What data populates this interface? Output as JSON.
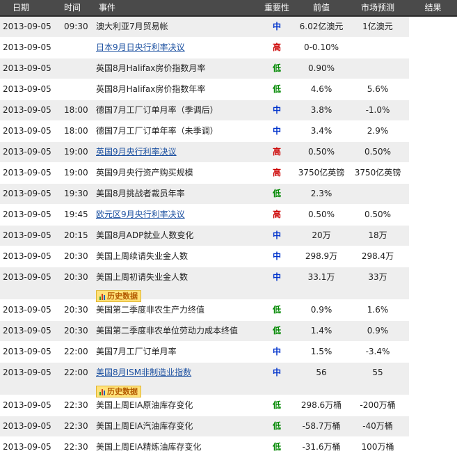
{
  "header": {
    "date": "日期",
    "time": "时间",
    "event": "事件",
    "importance": "重要性",
    "previous": "前值",
    "forecast": "市场预测",
    "result": "结果"
  },
  "history_label": "历史数据",
  "rows": [
    {
      "date": "2013-09-05",
      "time": "09:30",
      "event": "澳大利亚7月贸易帐",
      "link": false,
      "importance": "中",
      "level": "mid",
      "previous": "6.02亿澳元",
      "forecast": "1亿澳元",
      "history": false
    },
    {
      "date": "2013-09-05",
      "time": "",
      "event": "日本9月日央行利率决议",
      "link": true,
      "importance": "高",
      "level": "high",
      "previous": "0-0.10%",
      "forecast": "",
      "history": false
    },
    {
      "date": "2013-09-05",
      "time": "",
      "event": "英国8月Halifax房价指数月率",
      "link": false,
      "importance": "低",
      "level": "low",
      "previous": "0.90%",
      "forecast": "",
      "history": false
    },
    {
      "date": "2013-09-05",
      "time": "",
      "event": "英国8月Halifax房价指数年率",
      "link": false,
      "importance": "低",
      "level": "low",
      "previous": "4.6%",
      "forecast": "5.6%",
      "history": false
    },
    {
      "date": "2013-09-05",
      "time": "18:00",
      "event": "德国7月工厂订单月率（季调后）",
      "link": false,
      "importance": "中",
      "level": "mid",
      "previous": "3.8%",
      "forecast": "-1.0%",
      "history": false
    },
    {
      "date": "2013-09-05",
      "time": "18:00",
      "event": "德国7月工厂订单年率（未季调）",
      "link": false,
      "importance": "中",
      "level": "mid",
      "previous": "3.4%",
      "forecast": "2.9%",
      "history": false
    },
    {
      "date": "2013-09-05",
      "time": "19:00",
      "event": "英国9月央行利率决议",
      "link": true,
      "importance": "高",
      "level": "high",
      "previous": "0.50%",
      "forecast": "0.50%",
      "history": false
    },
    {
      "date": "2013-09-05",
      "time": "19:00",
      "event": "英国9月央行资产购买规模",
      "link": false,
      "importance": "高",
      "level": "high",
      "previous": "3750亿英镑",
      "forecast": "3750亿英镑",
      "history": false
    },
    {
      "date": "2013-09-05",
      "time": "19:30",
      "event": "美国8月挑战者裁员年率",
      "link": false,
      "importance": "低",
      "level": "low",
      "previous": "2.3%",
      "forecast": "",
      "history": false
    },
    {
      "date": "2013-09-05",
      "time": "19:45",
      "event": "欧元区9月央行利率决议",
      "link": true,
      "importance": "高",
      "level": "high",
      "previous": "0.50%",
      "forecast": "0.50%",
      "history": false
    },
    {
      "date": "2013-09-05",
      "time": "20:15",
      "event": "美国8月ADP就业人数变化",
      "link": false,
      "importance": "中",
      "level": "mid",
      "previous": "20万",
      "forecast": "18万",
      "history": false
    },
    {
      "date": "2013-09-05",
      "time": "20:30",
      "event": "美国上周续请失业金人数",
      "link": false,
      "importance": "中",
      "level": "mid",
      "previous": "298.9万",
      "forecast": "298.4万",
      "history": false
    },
    {
      "date": "2013-09-05",
      "time": "20:30",
      "event": "美国上周初请失业金人数",
      "link": false,
      "importance": "中",
      "level": "mid",
      "previous": "33.1万",
      "forecast": "33万",
      "history": true
    },
    {
      "date": "2013-09-05",
      "time": "20:30",
      "event": "美国第二季度非农生产力终值",
      "link": false,
      "importance": "低",
      "level": "low",
      "previous": "0.9%",
      "forecast": "1.6%",
      "history": false
    },
    {
      "date": "2013-09-05",
      "time": "20:30",
      "event": "美国第二季度非农单位劳动力成本终值",
      "link": false,
      "importance": "低",
      "level": "low",
      "previous": "1.4%",
      "forecast": "0.9%",
      "history": false
    },
    {
      "date": "2013-09-05",
      "time": "22:00",
      "event": "美国7月工厂订单月率",
      "link": false,
      "importance": "中",
      "level": "mid",
      "previous": "1.5%",
      "forecast": "-3.4%",
      "history": false
    },
    {
      "date": "2013-09-05",
      "time": "22:00",
      "event": "美国8月ISM非制造业指数",
      "link": true,
      "importance": "中",
      "level": "mid",
      "previous": "56",
      "forecast": "55",
      "history": true
    },
    {
      "date": "2013-09-05",
      "time": "22:30",
      "event": "美国上周EIA原油库存变化",
      "link": false,
      "importance": "低",
      "level": "low",
      "previous": "298.6万桶",
      "forecast": "-200万桶",
      "history": false
    },
    {
      "date": "2013-09-05",
      "time": "22:30",
      "event": "美国上周EIA汽油库存变化",
      "link": false,
      "importance": "低",
      "level": "low",
      "previous": "-58.7万桶",
      "forecast": "-40万桶",
      "history": false
    },
    {
      "date": "2013-09-05",
      "time": "22:30",
      "event": "美国上周EIA精炼油库存变化",
      "link": false,
      "importance": "低",
      "level": "low",
      "previous": "-31.6万桶",
      "forecast": "100万桶",
      "history": false
    }
  ],
  "colors": {
    "high": "#cc0000",
    "mid": "#0033cc",
    "low": "#008800",
    "link": "#1a4fa0",
    "header_bg": "#4a4a4a",
    "row_shade": "#eeeeee"
  }
}
